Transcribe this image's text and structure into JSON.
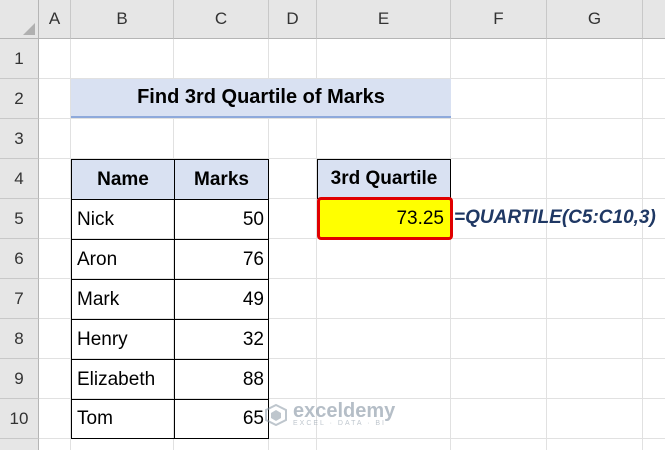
{
  "columns": [
    "A",
    "B",
    "C",
    "D",
    "E",
    "F",
    "G"
  ],
  "rows": [
    "1",
    "2",
    "3",
    "4",
    "5",
    "6",
    "7",
    "8",
    "9",
    "10"
  ],
  "title": "Find 3rd Quartile of Marks",
  "table": {
    "headers": [
      "Name",
      "Marks"
    ],
    "rows": [
      {
        "name": "Nick",
        "marks": "50"
      },
      {
        "name": "Aron",
        "marks": "76"
      },
      {
        "name": "Mark",
        "marks": "49"
      },
      {
        "name": "Henry",
        "marks": "32"
      },
      {
        "name": "Elizabeth",
        "marks": "88"
      },
      {
        "name": "Tom",
        "marks": "65"
      }
    ]
  },
  "result": {
    "header": "3rd Quartile",
    "value": "73.25",
    "formula": "=QUARTILE(C5:C10,3)"
  },
  "watermark": {
    "name": "exceldemy",
    "tagline": "EXCEL · DATA · BI"
  },
  "colors": {
    "header_fill": "#d9e1f2",
    "highlight": "#ffff00",
    "highlight_border": "#e00000",
    "formula_text": "#1f3864"
  }
}
